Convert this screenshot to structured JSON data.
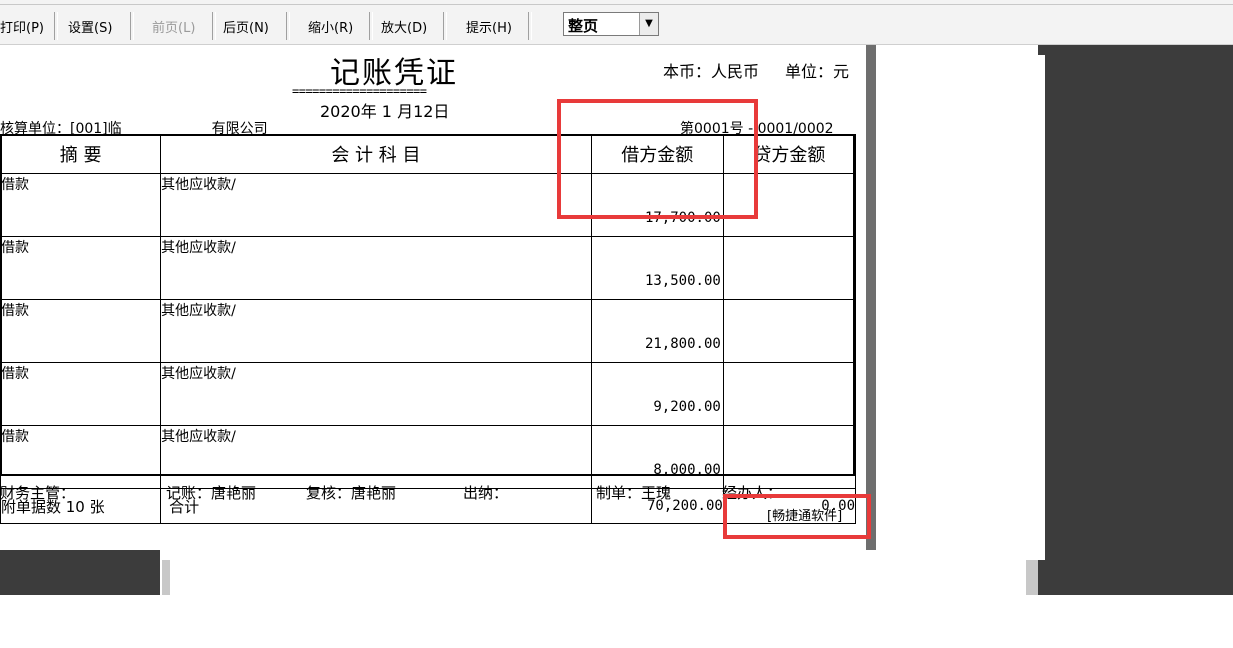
{
  "toolbar": {
    "print": "打印(P)",
    "settings": "设置(S)",
    "prev": "前页(L)",
    "next": "后页(N)",
    "zoom_out": "缩小(R)",
    "zoom_in": "放大(D)",
    "hint": "提示(H)",
    "view_mode": "整页"
  },
  "voucher": {
    "title": "记账凭证",
    "eq_line": "====================",
    "date": "2020年  1  月12日",
    "currency": "本币：人民币",
    "unit": "单位：元",
    "company": "核算单位：[001]临",
    "company_suffix": "有限公司",
    "voucher_no": "第0001号 - 0001/0002",
    "headers": {
      "summary": "摘    要",
      "account": "会  计  科  目",
      "debit": "借方金额",
      "credit": "贷方金额"
    },
    "rows": [
      {
        "summary": "借款",
        "account": "其他应收款/",
        "debit": "17,700.00",
        "credit": ""
      },
      {
        "summary": "借款",
        "account": "其他应收款/",
        "debit": "13,500.00",
        "credit": ""
      },
      {
        "summary": "借款",
        "account": "其他应收款/",
        "debit": "21,800.00",
        "credit": ""
      },
      {
        "summary": "借款",
        "account": "其他应收款/",
        "debit": "9,200.00",
        "credit": ""
      },
      {
        "summary": "借款",
        "account": "其他应收款/",
        "debit": "8,000.00",
        "credit": ""
      }
    ],
    "attachments": "附单据数    10   张",
    "total_label": "合计",
    "total_debit": "70,200.00",
    "total_credit": "0.00",
    "footer": {
      "supervisor": "财务主管：",
      "bookkeeper": "记账：唐艳丽",
      "reviewer": "复核：唐艳丽",
      "cashier": "出纳：",
      "maker": "制单：王瑰",
      "handler": "经办人："
    },
    "brand": "[畅捷通软件]"
  },
  "colors": {
    "highlight": "#e83a3a",
    "dark_pane": "#3c3c3c"
  }
}
